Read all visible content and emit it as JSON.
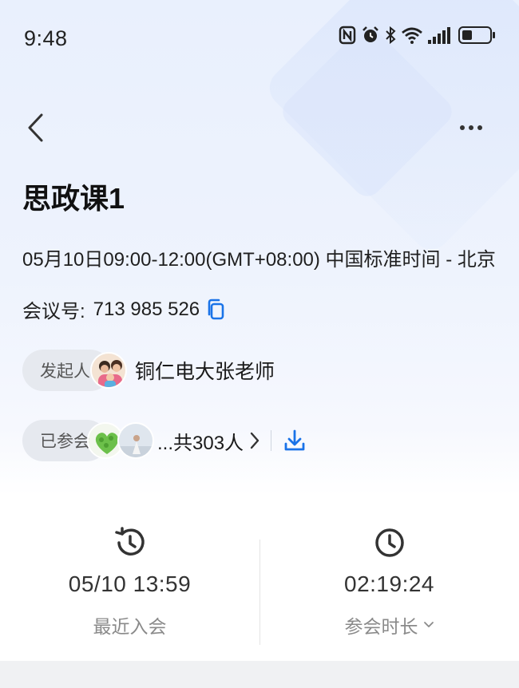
{
  "status_bar": {
    "time": "9:48",
    "icons": [
      "nfc-icon",
      "alarm-icon",
      "bluetooth-icon",
      "wifi-icon",
      "signal-icon",
      "battery-icon"
    ]
  },
  "meeting": {
    "title": "思政课1",
    "time_line": "05月10日09:00-12:00(GMT+08:00) 中国标准时间 - 北京",
    "id_label": "会议号:",
    "id_value": "713 985 526"
  },
  "host": {
    "label": "发起人",
    "name": "铜仁电大张老师"
  },
  "attendees": {
    "label": "已参会",
    "count_text": "...共303人",
    "chevron": "›"
  },
  "stats": {
    "recent_join": {
      "value": "05/10 13:59",
      "label": "最近入会"
    },
    "duration": {
      "value": "02:19:24",
      "label": "参会时长"
    }
  },
  "colors": {
    "accent": "#1a73e8",
    "background_top": "#e9f0fd",
    "pill_bg": "#e6e9ef"
  }
}
